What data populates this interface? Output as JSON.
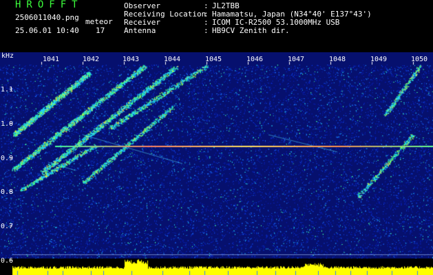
{
  "header": {
    "app_title": "HROFFT",
    "filename": "2506011040.png",
    "datetime": "25.06.01 10:40",
    "meteor_label": "meteor",
    "meteor_count": "17",
    "info": [
      {
        "label": "Observer",
        "value": "JL2TBB"
      },
      {
        "label": "Receiving Location",
        "value": "Hamamatsu, Japan (N34°40' E137°43')"
      },
      {
        "label": "Receiver",
        "value": "ICOM IC-R2500 53.1000MHz USB"
      },
      {
        "label": "Antenna",
        "value": "HB9CV Zenith dir."
      }
    ]
  },
  "spectrogram": {
    "y_unit": "kHz",
    "y_ticks": [
      "1.1",
      "1.0",
      "0.9",
      "0.8",
      "0.7",
      "0.6"
    ],
    "x_ticks": [
      "1041",
      "1042",
      "1043",
      "1044",
      "1045",
      "1046",
      "1047",
      "1048",
      "1049",
      "1050"
    ]
  },
  "colors": {
    "background": "#000000",
    "title_green": "#3cff3c",
    "text": "#ffffff",
    "noise_base": "#0a1a8c",
    "carrier_line": "#ffe060",
    "power_trace": "#ffff00"
  }
}
